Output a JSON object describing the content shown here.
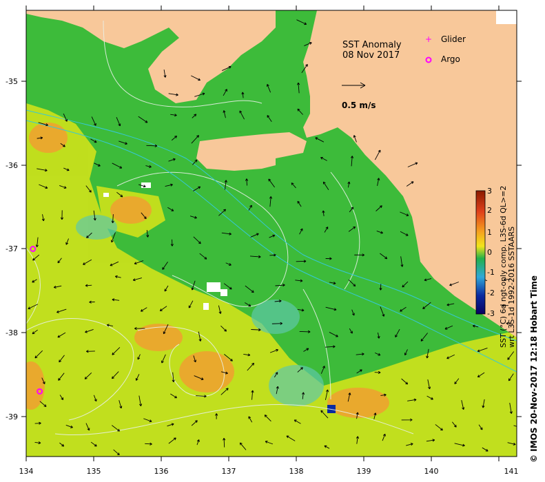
{
  "title": "SST Anomaly",
  "date": "08 Nov 2017",
  "legend": {
    "glider_label": "Glider",
    "argo_label": "Argo",
    "marker_color": "#ff00ff"
  },
  "scale_arrow": {
    "label": "0.5 m/s"
  },
  "colorbar": {
    "ticks": [
      "3",
      "2",
      "1",
      "0",
      "-1",
      "-2",
      "-3"
    ],
    "stops": [
      "#8b1a00",
      "#e0401a",
      "#f5a020",
      "#f2e51a",
      "#22b04a",
      "#2fa8d8",
      "#0a2aa0",
      "#0a0060"
    ],
    "caption_line1": "SST (°C) 6d ngt-only comp. L3S-6d QL>=2",
    "caption_line2": "wrt L3S-1d 1992-2016 SSTAARS"
  },
  "credit": "© IMOS 20-Nov-2017 12:18 Hobart Time",
  "axes": {
    "x_ticks": [
      "134",
      "135",
      "136",
      "137",
      "138",
      "139",
      "140",
      "141"
    ],
    "y_ticks": [
      "-35",
      "-36",
      "-37",
      "-38",
      "-39"
    ]
  },
  "colors": {
    "land": "#f8c89a",
    "sea_base": "#3dbb3a",
    "warm_anomaly": "#c8e01c",
    "hot_anomaly": "#f0a030",
    "cool_anomaly": "#5ec8a8",
    "current_arrow": "#000000",
    "contour": "#e8f0e8",
    "bathymetry": "#36c8d8"
  },
  "argo_floats": [
    {
      "lon": 134.1,
      "lat": -37.0
    },
    {
      "lon": 134.2,
      "lat": -38.7
    }
  ]
}
